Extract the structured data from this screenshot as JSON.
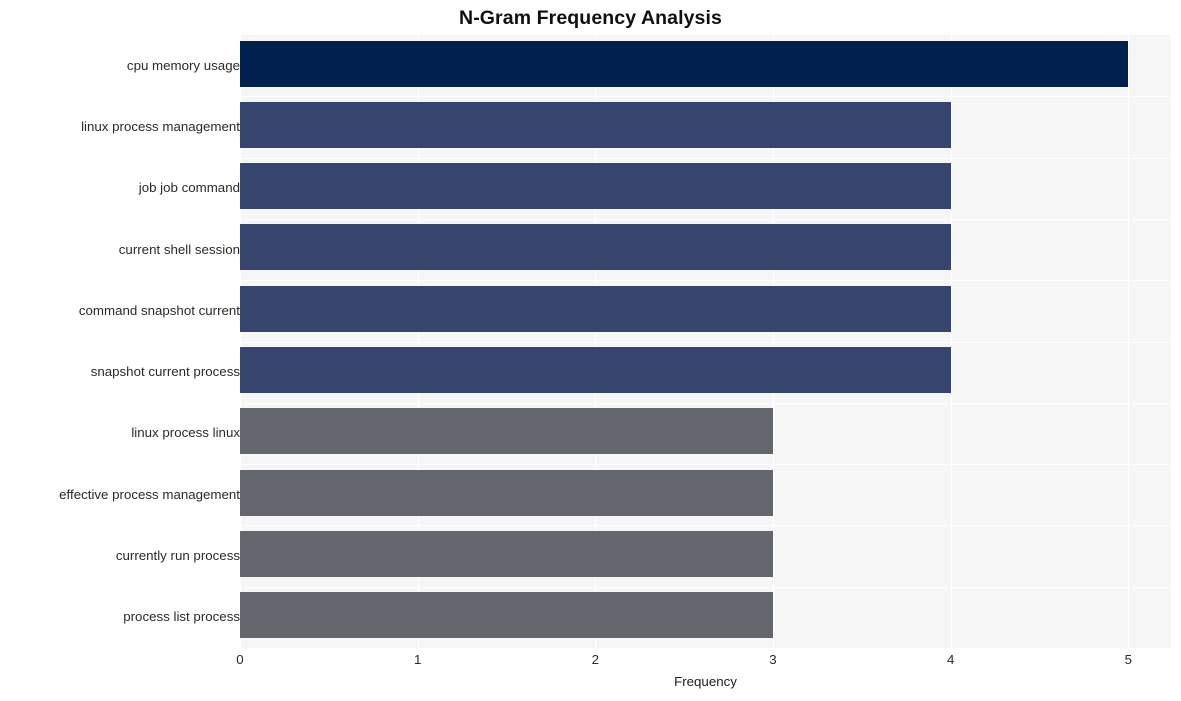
{
  "chart_data": {
    "type": "bar",
    "orientation": "horizontal",
    "title": "N-Gram Frequency Analysis",
    "xlabel": "Frequency",
    "ylabel": "",
    "categories": [
      "cpu memory usage",
      "linux process management",
      "job job command",
      "current shell session",
      "command snapshot current",
      "snapshot current process",
      "linux process linux",
      "effective process management",
      "currently run process",
      "process list process"
    ],
    "values": [
      5,
      4,
      4,
      4,
      4,
      4,
      3,
      3,
      3,
      3
    ],
    "bar_colors": [
      "#002050",
      "#36456d",
      "#36456d",
      "#36456d",
      "#36456d",
      "#36456d",
      "#64666e",
      "#64666e",
      "#64666e",
      "#64666e"
    ],
    "xlim": [
      0,
      5.24
    ],
    "xticks": [
      0,
      1,
      2,
      3,
      4,
      5
    ],
    "xtick_labels": [
      "0",
      "1",
      "2",
      "3",
      "4",
      "5"
    ],
    "grid": true,
    "grid_color": "#ffffff",
    "plot_background": "#f6f6f7",
    "figure_background": "#ffffff",
    "legend": null
  }
}
